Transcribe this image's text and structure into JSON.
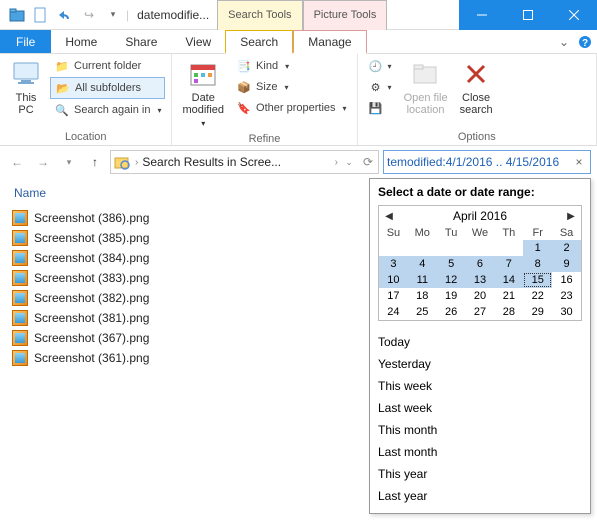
{
  "window": {
    "title": "datemodifie..."
  },
  "tool_tabs": {
    "search": "Search Tools",
    "picture": "Picture Tools"
  },
  "menu": {
    "file": "File",
    "home": "Home",
    "share": "Share",
    "view": "View",
    "search": "Search",
    "manage": "Manage"
  },
  "ribbon": {
    "location": {
      "label": "Location",
      "this_pc": "This\nPC",
      "current_folder": "Current folder",
      "all_subfolders": "All subfolders",
      "search_again": "Search again in"
    },
    "refine": {
      "label": "Refine",
      "date_modified": "Date\nmodified",
      "kind": "Kind",
      "size": "Size",
      "other_props": "Other properties"
    },
    "options": {
      "label": "Options",
      "recent": "Recent\nsearches",
      "advanced": "Advanced\noptions",
      "save": "Save\nsearch",
      "open_loc": "Open file\nlocation",
      "close": "Close\nsearch"
    }
  },
  "nav": {
    "breadcrumb": "Search Results in Scree...",
    "search_value": "temodified:4/1/2016 .. 4/15/2016"
  },
  "columns": {
    "name": "Name"
  },
  "files": [
    "Screenshot (386).png",
    "Screenshot (385).png",
    "Screenshot (384).png",
    "Screenshot (383).png",
    "Screenshot (382).png",
    "Screenshot (381).png",
    "Screenshot (367).png",
    "Screenshot (361).png"
  ],
  "flyout": {
    "title": "Select a date or date range:",
    "month": "April 2016",
    "dow": [
      "Su",
      "Mo",
      "Tu",
      "We",
      "Th",
      "Fr",
      "Sa"
    ],
    "days": [
      {
        "n": "",
        "s": 0
      },
      {
        "n": "",
        "s": 0
      },
      {
        "n": "",
        "s": 0
      },
      {
        "n": "",
        "s": 0
      },
      {
        "n": "",
        "s": 0
      },
      {
        "n": "1",
        "s": 1
      },
      {
        "n": "2",
        "s": 1
      },
      {
        "n": "3",
        "s": 1
      },
      {
        "n": "4",
        "s": 1
      },
      {
        "n": "5",
        "s": 1
      },
      {
        "n": "6",
        "s": 1
      },
      {
        "n": "7",
        "s": 1
      },
      {
        "n": "8",
        "s": 1
      },
      {
        "n": "9",
        "s": 1
      },
      {
        "n": "10",
        "s": 1
      },
      {
        "n": "11",
        "s": 1
      },
      {
        "n": "12",
        "s": 1
      },
      {
        "n": "13",
        "s": 1
      },
      {
        "n": "14",
        "s": 1
      },
      {
        "n": "15",
        "s": 2
      },
      {
        "n": "16",
        "s": 0
      },
      {
        "n": "17",
        "s": 0
      },
      {
        "n": "18",
        "s": 0
      },
      {
        "n": "19",
        "s": 0
      },
      {
        "n": "20",
        "s": 0
      },
      {
        "n": "21",
        "s": 0
      },
      {
        "n": "22",
        "s": 0
      },
      {
        "n": "23",
        "s": 0
      },
      {
        "n": "24",
        "s": 0
      },
      {
        "n": "25",
        "s": 0
      },
      {
        "n": "26",
        "s": 0
      },
      {
        "n": "27",
        "s": 0
      },
      {
        "n": "28",
        "s": 0
      },
      {
        "n": "29",
        "s": 0
      },
      {
        "n": "30",
        "s": 0
      }
    ],
    "presets": [
      "Today",
      "Yesterday",
      "This week",
      "Last week",
      "This month",
      "Last month",
      "This year",
      "Last year"
    ]
  }
}
